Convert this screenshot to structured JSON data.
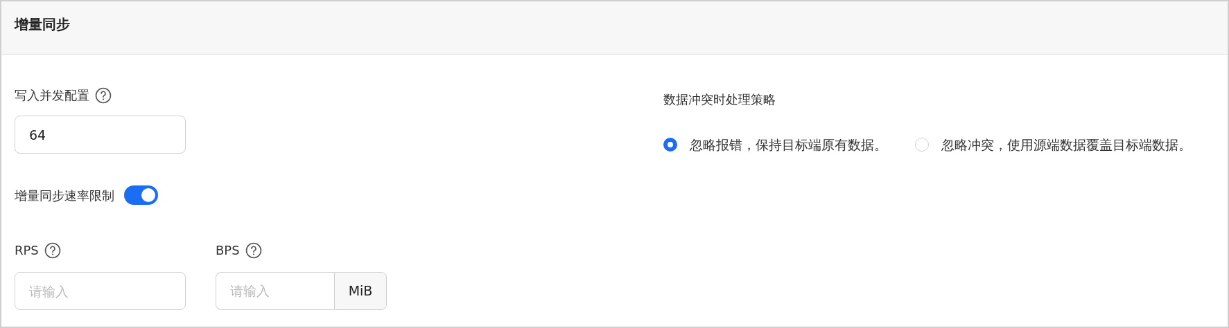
{
  "header": {
    "title": "增量同步"
  },
  "concurrency": {
    "label": "写入并发配置",
    "value": "64"
  },
  "rate_limit": {
    "label": "增量同步速率限制",
    "on": true
  },
  "rps": {
    "label": "RPS",
    "placeholder": "请输入"
  },
  "bps": {
    "label": "BPS",
    "placeholder": "请输入",
    "unit": "MiB"
  },
  "conflict": {
    "label": "数据冲突时处理策略",
    "options": [
      {
        "label": "忽略报错，保持目标端原有数据。",
        "selected": true
      },
      {
        "label": "忽略冲突，使用源端数据覆盖目标端数据。",
        "selected": false
      }
    ]
  }
}
